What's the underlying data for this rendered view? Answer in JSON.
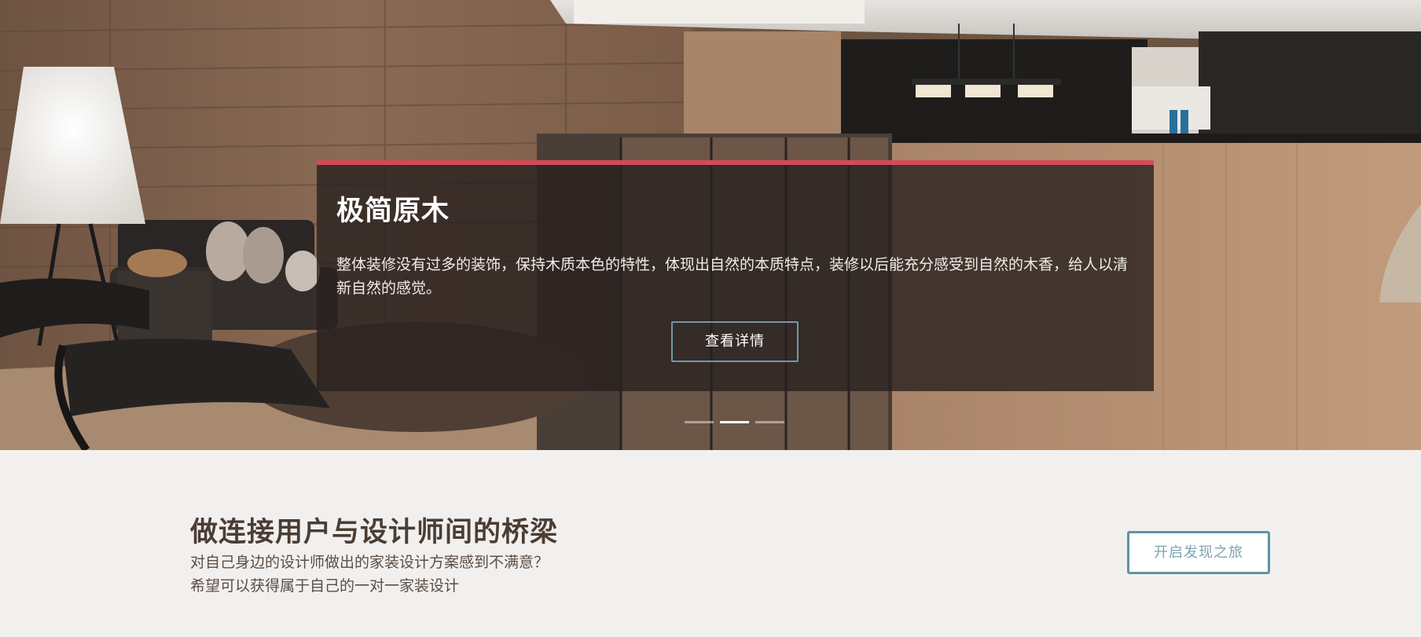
{
  "hero": {
    "slide": {
      "title": "极简原木",
      "description": "整体装修没有过多的装饰，保持木质本色的特性，体现出自然的本质特点，装修以后能充分感受到自然的木香，给人以清新自然的感觉。",
      "button_label": "查看详情"
    },
    "slider": {
      "slide_count": 3,
      "active_index": 1
    },
    "accent_color": "#d44a57"
  },
  "intro": {
    "heading": "做连接用户与设计师间的桥梁",
    "text_line1": "对自己身边的设计师做出的家装设计方案感到不满意？",
    "text_line2": "希望可以获得属于自己的一对一家装设计",
    "button_label": "开启发现之旅",
    "button_border_color": "#5f93a4"
  }
}
